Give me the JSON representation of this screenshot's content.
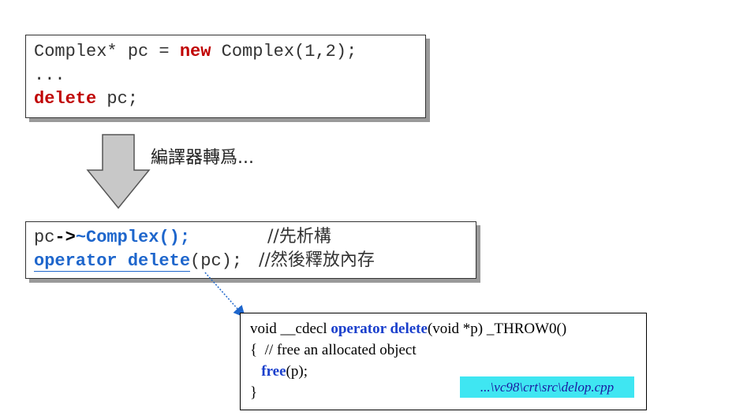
{
  "box1": {
    "line1": {
      "a": "Complex* pc = ",
      "kw": "new",
      "b": " Complex(1,2);"
    },
    "line2": "...",
    "line3": {
      "kw": "delete",
      "b": " pc;"
    }
  },
  "caption": "編譯器轉爲...",
  "box2": {
    "line1": {
      "a": "pc",
      "arrow": "->",
      "fn": "~Complex",
      "b": "();",
      "comment": "              //先析構"
    },
    "line2": {
      "fn": "operator delete",
      "b": "(pc);",
      "comment": "   //然後釋放內存"
    }
  },
  "box3": {
    "line1": {
      "a": "void __cdecl ",
      "kw": "operator delete",
      "b": "(void *p) _THROW0()"
    },
    "line2": "{  // free an allocated object",
    "line3": {
      "indent": "   ",
      "kw": "free",
      "b": "(p);"
    },
    "line4": "}",
    "path": "...\\vc98\\crt\\src\\delop.cpp"
  },
  "colors": {
    "keyword_red": "#c00000",
    "keyword_blue": "#1e66cc",
    "path_bg": "#3fe6f2"
  }
}
